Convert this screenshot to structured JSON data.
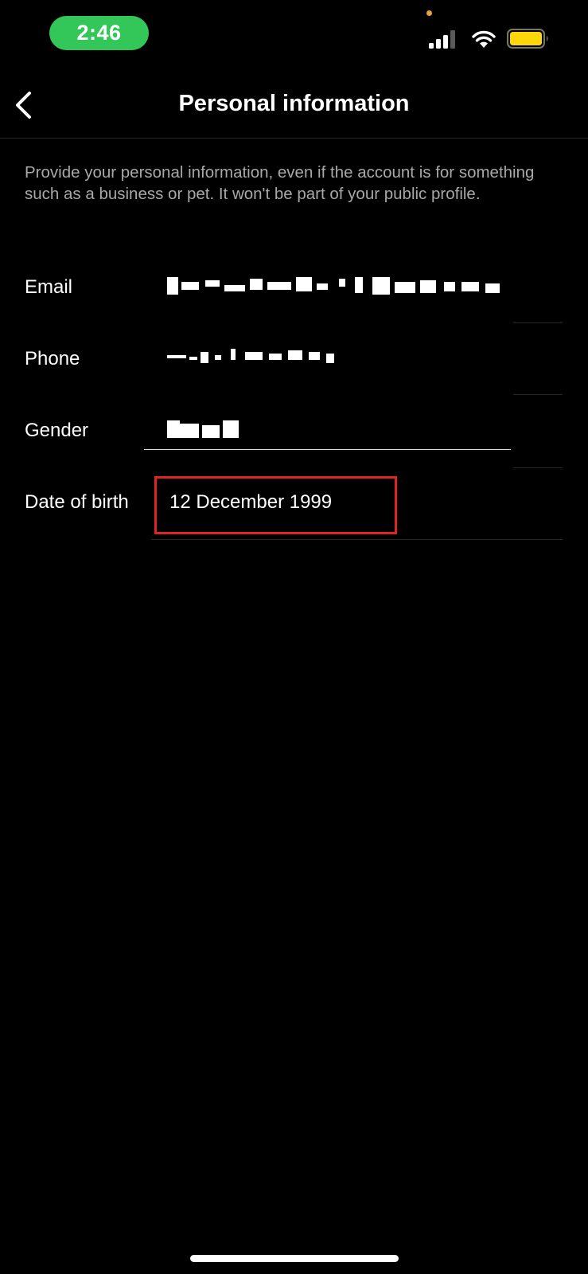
{
  "status_bar": {
    "time": "2:46",
    "icons": [
      "signal-icon",
      "wifi-icon",
      "battery-icon"
    ],
    "colors": {
      "time_pill": "#33c759",
      "battery_fill": "#ffd60a",
      "camera_dot": "#e6a23c"
    }
  },
  "header": {
    "title": "Personal information",
    "back_icon": "chevron-left-icon"
  },
  "description": "Provide your personal information, even if the account is for something such as a business or pet. It won't be part of your public profile.",
  "fields": {
    "email": {
      "label": "Email"
    },
    "phone": {
      "label": "Phone"
    },
    "gender": {
      "label": "Gender"
    },
    "date_of_birth": {
      "label": "Date of birth",
      "value": "12 December 1999"
    }
  },
  "annotation": {
    "color": "#e02424"
  }
}
